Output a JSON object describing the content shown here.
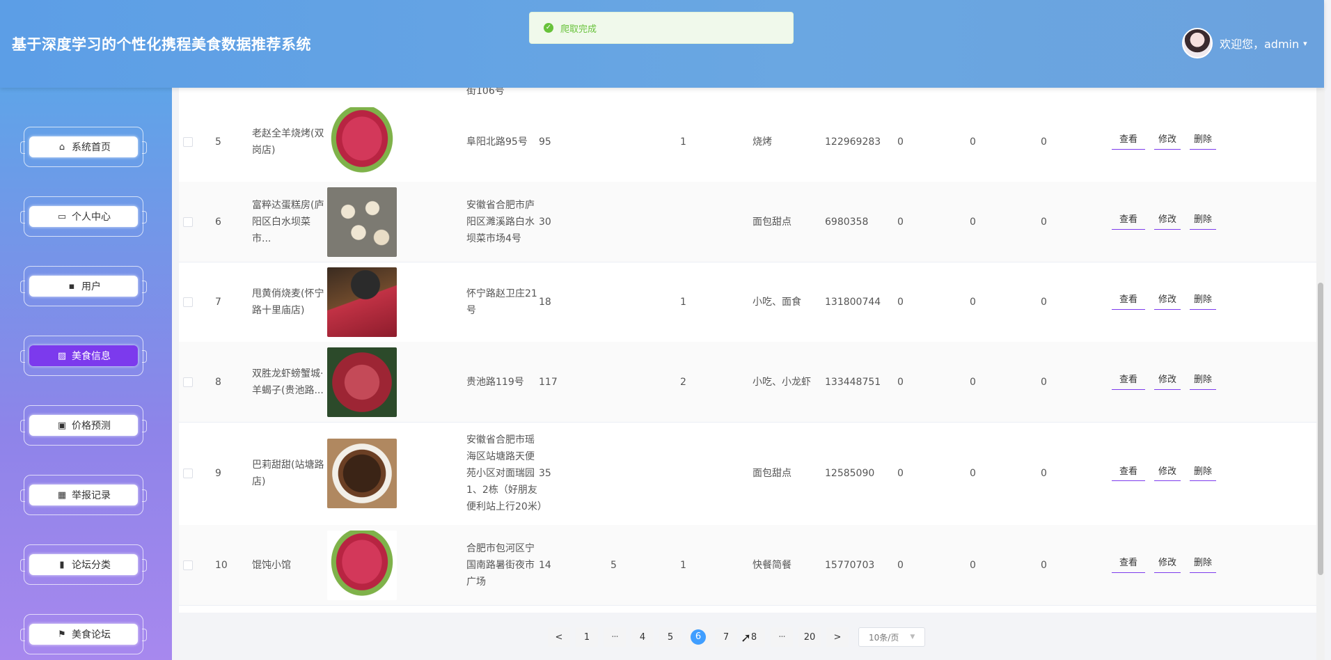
{
  "app": {
    "title": "基于深度学习的个性化携程美食数据推荐系统"
  },
  "user": {
    "welcome": "欢迎您，admin",
    "caret": "▾"
  },
  "toast": {
    "text": "爬取完成",
    "icon": "✓"
  },
  "sidebar": {
    "items": [
      {
        "label": "系统首页",
        "icon": "home-icon",
        "glyph": "⌂"
      },
      {
        "label": "个人中心",
        "icon": "card-icon",
        "glyph": "▭"
      },
      {
        "label": "用户",
        "icon": "chat-icon",
        "glyph": "▪"
      },
      {
        "label": "美食信息",
        "icon": "chart-icon",
        "glyph": "▨"
      },
      {
        "label": "价格预测",
        "icon": "clipboard-icon",
        "glyph": "▣"
      },
      {
        "label": "举报记录",
        "icon": "grid-icon",
        "glyph": "▦"
      },
      {
        "label": "论坛分类",
        "icon": "bar-chart-icon",
        "glyph": "▮"
      },
      {
        "label": "美食论坛",
        "icon": "flag-icon",
        "glyph": "⚑"
      }
    ],
    "active_index": 3
  },
  "table": {
    "partial_top_text": "街106号",
    "rows": [
      {
        "idx": "5",
        "name": "老赵全羊烧烤(双岗店)",
        "addr": "阜阳北路95号",
        "price": "95",
        "col7": "",
        "col8": "1",
        "category": "烧烤",
        "phone": "122969283",
        "z1": "0",
        "z2": "0",
        "z3": "0",
        "image": "meat-image"
      },
      {
        "idx": "6",
        "name": "富粹达蛋糕房(庐阳区白水坝菜市...",
        "addr": "安徽省合肥市庐阳区濉溪路白水坝菜市场4号",
        "price": "30",
        "col7": "",
        "col8": "",
        "category": "面包甜点",
        "phone": "6980358",
        "z1": "0",
        "z2": "0",
        "z3": "0",
        "image": "dessert-image"
      },
      {
        "idx": "7",
        "name": "甩黄俏烧麦(怀宁路十里庙店)",
        "addr": "怀宁路赵卫庄21号",
        "price": "18",
        "col7": "",
        "col8": "1",
        "category": "小吃、面食",
        "phone": "131800744",
        "z1": "0",
        "z2": "0",
        "z3": "0",
        "image": "hotpot-image"
      },
      {
        "idx": "8",
        "name": "双胜龙虾螃蟹城·羊蝎子(贵池路...",
        "addr": "贵池路119号",
        "price": "117",
        "col7": "",
        "col8": "2",
        "category": "小吃、小龙虾",
        "phone": "133448751",
        "z1": "0",
        "z2": "0",
        "z3": "0",
        "image": "steak-image"
      },
      {
        "idx": "9",
        "name": "巴莉甜甜(站塘路店)",
        "addr": "安徽省合肥市瑶海区站塘路天便苑小区对面瑞园1、2栋（好朋友便利站上行20米）",
        "price": "35",
        "col7": "",
        "col8": "",
        "category": "面包甜点",
        "phone": "12585090",
        "z1": "0",
        "z2": "0",
        "z3": "0",
        "image": "wings-image"
      },
      {
        "idx": "10",
        "name": "馄饨小馆",
        "addr": "合肥市包河区宁国南路暑街夜市广场",
        "price": "14",
        "col7": "5",
        "col8": "1",
        "category": "快餐简餐",
        "phone": "15770703",
        "z1": "0",
        "z2": "0",
        "z3": "0",
        "image": "meat-image"
      }
    ],
    "actions": {
      "view": "查看",
      "edit": "修改",
      "delete": "删除"
    }
  },
  "pagination": {
    "prev": "<",
    "next": ">",
    "ellipsis": "···",
    "pages": [
      "1",
      "4",
      "5",
      "6",
      "7",
      "8",
      "20"
    ],
    "current": "6",
    "page_size": "10条/页"
  },
  "colors": {
    "accent": "#7c3aed",
    "header": "#6aa7e2",
    "pager_active": "#409eff",
    "toast": "#67c23a"
  }
}
